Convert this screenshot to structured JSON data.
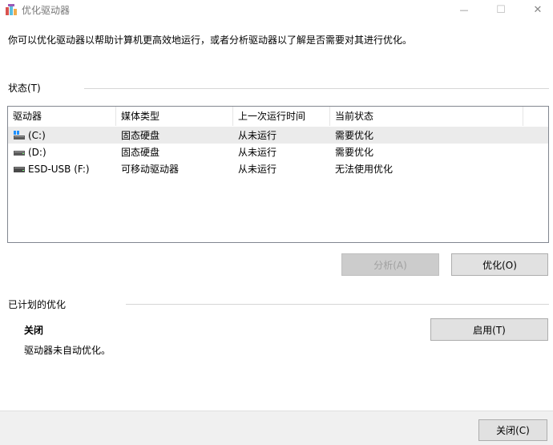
{
  "window": {
    "title": "优化驱动器",
    "minimize_glyph": "—",
    "maximize_glyph": "☐",
    "close_glyph": "✕"
  },
  "description": "你可以优化驱动器以帮助计算机更高效地运行，或者分析驱动器以了解是否需要对其进行优化。",
  "status": {
    "label": "状态(T)",
    "columns": [
      "驱动器",
      "媒体类型",
      "上一次运行时间",
      "当前状态"
    ],
    "rows": [
      {
        "drive": "(C:)",
        "media": "固态硬盘",
        "last_run": "从未运行",
        "state": "需要优化",
        "icon": "system-drive-icon",
        "selected": true
      },
      {
        "drive": "(D:)",
        "media": "固态硬盘",
        "last_run": "从未运行",
        "state": "需要优化",
        "icon": "drive-icon",
        "selected": false
      },
      {
        "drive": "ESD-USB (F:)",
        "media": "可移动驱动器",
        "last_run": "从未运行",
        "state": "无法使用优化",
        "icon": "usb-drive-icon",
        "selected": false
      }
    ],
    "analyze_label": "分析(A)",
    "optimize_label": "优化(O)"
  },
  "scheduled": {
    "label": "已计划的优化",
    "status": "关闭",
    "description": "驱动器未自动优化。",
    "enable_label": "启用(T)"
  },
  "footer": {
    "close_label": "关闭(C)"
  },
  "colors": {
    "selected_row": "#ebebeb",
    "button_bg": "#e1e1e1",
    "footer_bg": "#f0f0f0"
  }
}
